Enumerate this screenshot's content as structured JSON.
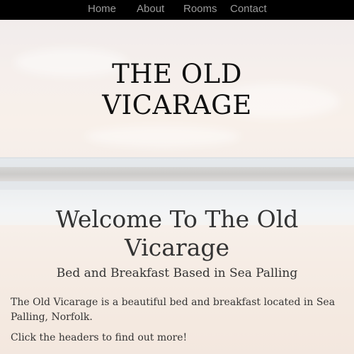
{
  "nav": {
    "items": [
      {
        "label": "Home"
      },
      {
        "label": "About"
      },
      {
        "label": "Rooms"
      },
      {
        "label": "Contact"
      }
    ]
  },
  "hero": {
    "title_line1": "THE OLD",
    "title_line2": "VICARAGE",
    "background": "beach-and-sea-photo"
  },
  "main": {
    "welcome_line1": "Welcome To The Old",
    "welcome_line2": "Vicarage",
    "subtitle": "Bed and Breakfast Based in Sea Palling",
    "intro_line1": "The Old Vicarage is a beautiful bed and breakfast located in Sea",
    "intro_line2": "Palling, Norfolk.",
    "cta": "Click the headers to find out more!"
  },
  "colors": {
    "nav_bg": "#000000",
    "nav_text": "#9a9a9a",
    "text": "#333333"
  }
}
